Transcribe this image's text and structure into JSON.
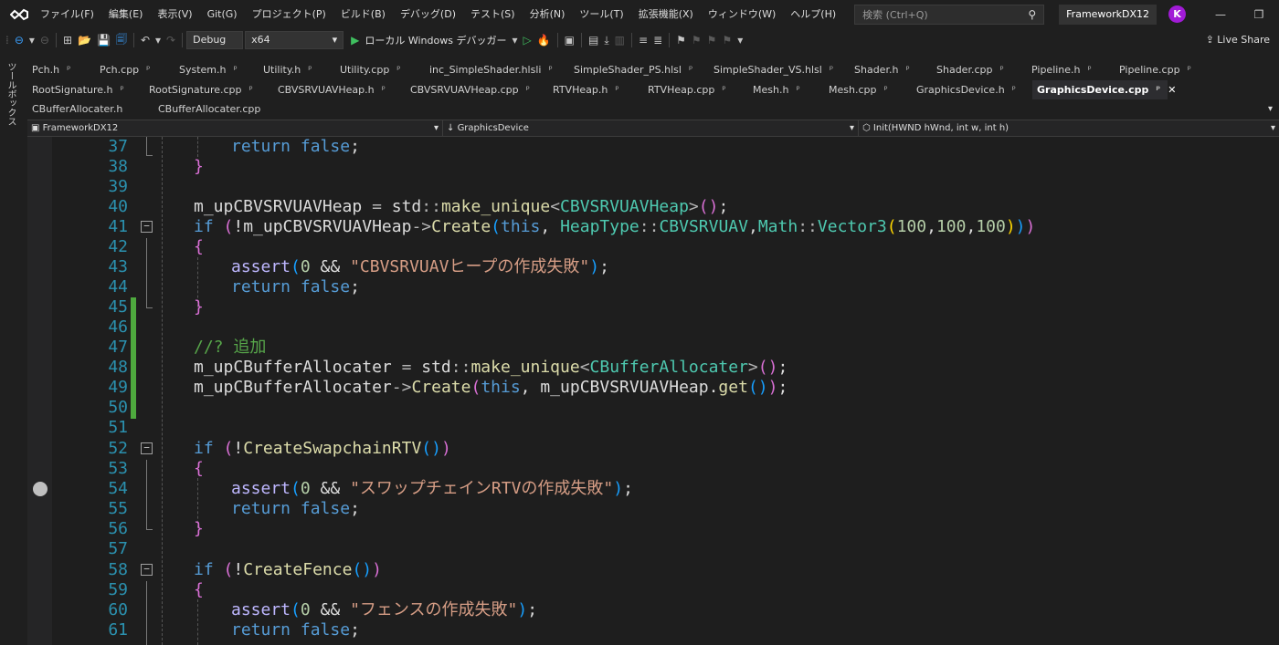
{
  "menu": {
    "items": [
      "ファイル(F)",
      "編集(E)",
      "表示(V)",
      "Git(G)",
      "プロジェクト(P)",
      "ビルド(B)",
      "デバッグ(D)",
      "テスト(S)",
      "分析(N)",
      "ツール(T)",
      "拡張機能(X)",
      "ウィンドウ(W)",
      "ヘルプ(H)"
    ],
    "search_placeholder": "検索 (Ctrl+Q)",
    "solution_name": "FrameworkDX12",
    "avatar_initial": "K"
  },
  "toolbar": {
    "config": "Debug",
    "platform": "x64",
    "run_label": "ローカル Windows デバッガー",
    "live_share": "Live Share"
  },
  "side_strip_label": "ツールボックス",
  "tabs": {
    "row1": [
      "Pch.h",
      "Pch.cpp",
      "System.h",
      "Utility.h",
      "Utility.cpp",
      "inc_SimpleShader.hlsli",
      "SimpleShader_PS.hlsl",
      "SimpleShader_VS.hlsl",
      "Shader.h",
      "Shader.cpp",
      "Pipeline.h",
      "Pipeline.cpp"
    ],
    "row2": [
      "RootSignature.h",
      "RootSignature.cpp",
      "CBVSRVUAVHeap.h",
      "CBVSRVUAVHeap.cpp",
      "RTVHeap.h",
      "RTVHeap.cpp",
      "Mesh.h",
      "Mesh.cpp",
      "GraphicsDevice.h"
    ],
    "active": "GraphicsDevice.cpp",
    "row3": [
      "CBufferAllocater.h",
      "CBufferAllocater.cpp"
    ],
    "pin_glyph": "ᵖ",
    "close_glyph": "✕"
  },
  "navbar": {
    "project": "FrameworkDX12",
    "scope": "GraphicsDevice",
    "member": "Init(HWND hWnd, int w, int h)"
  },
  "editor": {
    "line_numbers": [
      "37",
      "38",
      "39",
      "40",
      "41",
      "42",
      "43",
      "44",
      "45",
      "46",
      "47",
      "48",
      "49",
      "50",
      "51",
      "52",
      "53",
      "54",
      "55",
      "56",
      "57",
      "58",
      "59",
      "60",
      "61"
    ],
    "comment_text": "//? 追加",
    "assert_msg_1": "\"CBVSRVUAVヒープの作成失敗\"",
    "assert_msg_2": "\"スワップチェインRTVの作成失敗\"",
    "assert_msg_3": "\"フェンスの作成失敗\""
  },
  "colors": {
    "accent": "#a11bd6",
    "line_number": "#2b91af",
    "keyword": "#569cd6",
    "string": "#d69d85",
    "change_bar": "#4ea93e"
  }
}
